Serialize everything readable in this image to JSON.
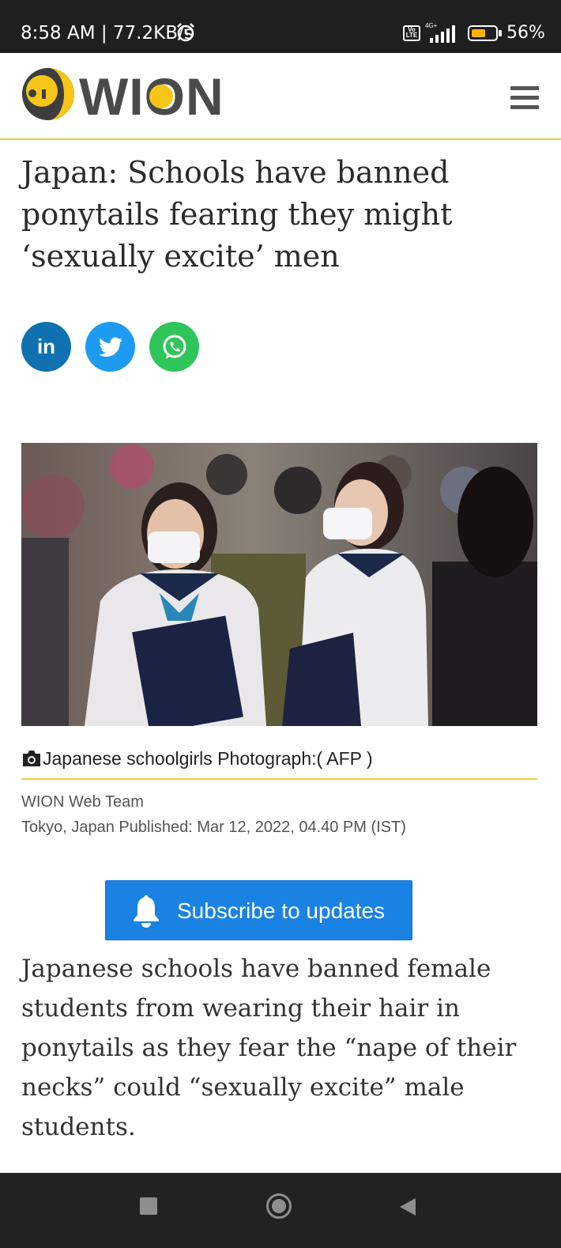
{
  "status_bar": {
    "time_speed": "8:58 AM | 77.2KB/s",
    "volte": "Vo LTE",
    "network": "4G+",
    "battery": "56%",
    "battery_level": 0.56,
    "icons": [
      "alarm-icon",
      "volte-icon",
      "signal-icon",
      "battery-icon"
    ]
  },
  "header": {
    "logo_text": "WION",
    "brand_color": "#f5c518",
    "menu_icon": "hamburger-menu-icon"
  },
  "article": {
    "headline": "Japan: Schools have banned ponytails fearing they might ‘sexually excite’ men",
    "share": {
      "linkedin": "in",
      "icons": [
        "linkedin-icon",
        "twitter-icon",
        "whatsapp-icon"
      ]
    },
    "image_caption": "Japanese schoolgirls Photograph:( AFP )",
    "author": "WION Web Team",
    "dateline": "Tokyo, Japan Published: Mar 12, 2022, 04.40 PM (IST)",
    "subscribe_label": "Subscribe to updates",
    "body": "Japanese schools have banned female students from wearing their hair in ponytails as they fear the “nape of their necks” could “sexually excite” male students."
  },
  "colors": {
    "accent_line": "#f0cf36",
    "subscribe_button": "#1a82e2",
    "linkedin": "#0f71b0",
    "twitter": "#1d9bf0",
    "whatsapp": "#2fc55a"
  },
  "nav_bar": {
    "icons": [
      "recent-apps-icon",
      "home-icon",
      "back-icon"
    ]
  }
}
